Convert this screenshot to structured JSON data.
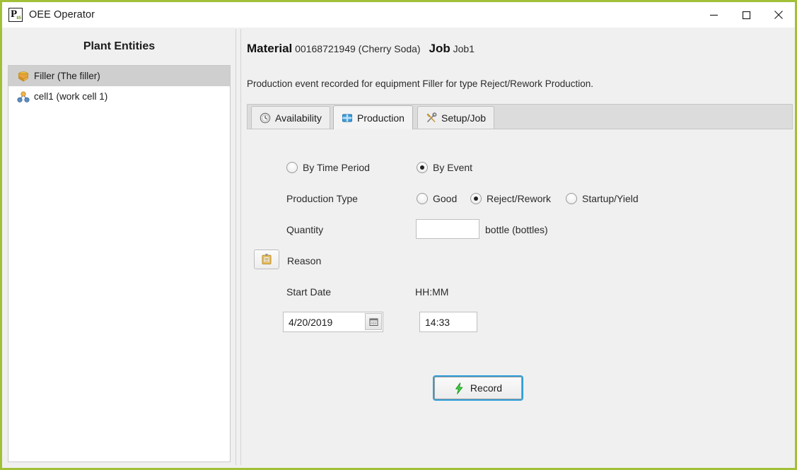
{
  "window": {
    "title": "OEE Operator",
    "app_icon": "px-logo-icon",
    "accent_border_color": "#a2c037",
    "controls": {
      "minimize": "minimize-icon",
      "maximize": "maximize-icon",
      "close": "close-icon"
    }
  },
  "sidebar": {
    "title": "Plant Entities",
    "items": [
      {
        "label": "Filler (The filler)",
        "icon": "equipment-box-icon",
        "selected": true
      },
      {
        "label": "cell1 (work cell 1)",
        "icon": "work-cell-icon",
        "selected": false
      }
    ]
  },
  "header": {
    "material_label": "Material",
    "material_value": "00168721949 (Cherry Soda)",
    "job_label": "Job",
    "job_value": "Job1",
    "description": "Production event recorded for equipment Filler for type Reject/Rework Production."
  },
  "tabs": [
    {
      "label": "Availability",
      "icon": "clock-icon",
      "active": false
    },
    {
      "label": "Production",
      "icon": "box-icon",
      "active": true
    },
    {
      "label": "Setup/Job",
      "icon": "tools-icon",
      "active": false
    }
  ],
  "form": {
    "mode_options": [
      {
        "label": "By Time Period",
        "selected": false
      },
      {
        "label": "By Event",
        "selected": true
      }
    ],
    "production_type_label": "Production Type",
    "production_type_options": [
      {
        "label": "Good",
        "selected": false
      },
      {
        "label": "Reject/Rework",
        "selected": true
      },
      {
        "label": "Startup/Yield",
        "selected": false
      }
    ],
    "quantity_label": "Quantity",
    "quantity_value": "",
    "quantity_placeholder": "",
    "quantity_unit": "bottle (bottles)",
    "reason_label": "Reason",
    "reason_icon": "clipboard-icon",
    "start_date_label": "Start Date",
    "start_date_value": "4/20/2019",
    "calendar_icon": "calendar-icon",
    "time_label": "HH:MM",
    "time_value": "14:33",
    "record_label": "Record",
    "record_icon": "lightning-bolt-icon"
  }
}
